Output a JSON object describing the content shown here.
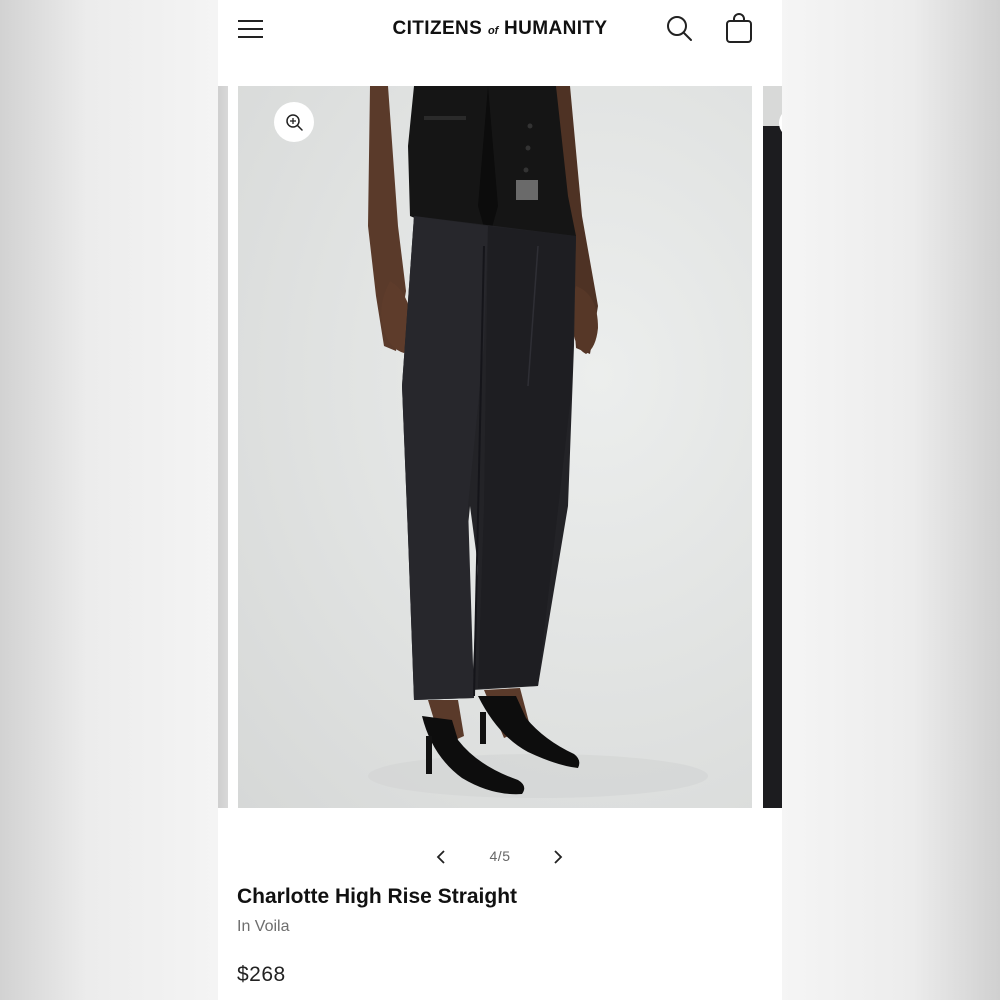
{
  "header": {
    "brand_left": "CITIZENS",
    "brand_of": "of",
    "brand_right": "HUMANITY",
    "menu_icon": "hamburger-menu-icon",
    "search_icon": "search-icon",
    "cart_icon": "shopping-bag-icon"
  },
  "gallery": {
    "zoom_icon": "zoom-in-icon",
    "image_description_icon": "product-photo"
  },
  "pager": {
    "prev_icon": "chevron-left-icon",
    "count": "4/5",
    "next_icon": "chevron-right-icon"
  },
  "product": {
    "title": "Charlotte High Rise Straight",
    "variant": "In Voila",
    "price": "$268"
  },
  "colors": {
    "background": "#ffffff",
    "text": "#111111",
    "muted": "#6e6e6e"
  }
}
